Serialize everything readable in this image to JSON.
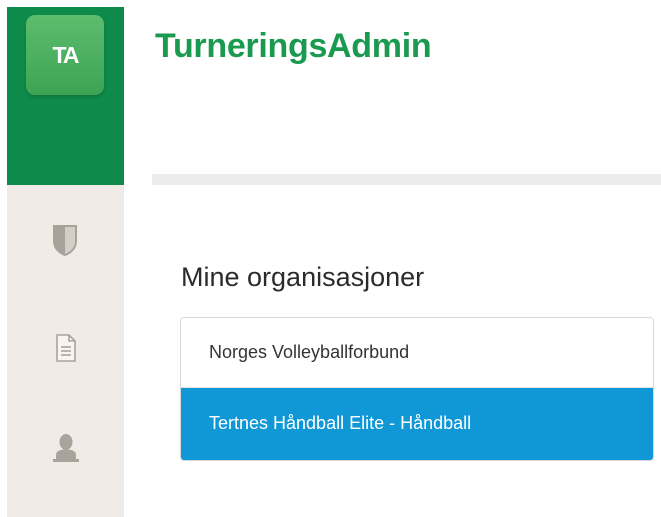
{
  "app": {
    "logo_text": "TA",
    "title": "TurneringsAdmin"
  },
  "sidebar": {
    "items": [
      {
        "icon": "shield-icon"
      },
      {
        "icon": "document-icon"
      },
      {
        "icon": "user-icon"
      }
    ]
  },
  "colors": {
    "brand_green": "#0e8a4a",
    "title_green": "#1a9a4f",
    "active_blue": "#0f97d6",
    "sidebar_bg": "#f0ebe7"
  },
  "main": {
    "heading": "Mine organisasjoner",
    "organizations": [
      {
        "label": "Norges Volleyballforbund",
        "active": false
      },
      {
        "label": "Tertnes Håndball Elite - Håndball",
        "active": true
      }
    ]
  }
}
